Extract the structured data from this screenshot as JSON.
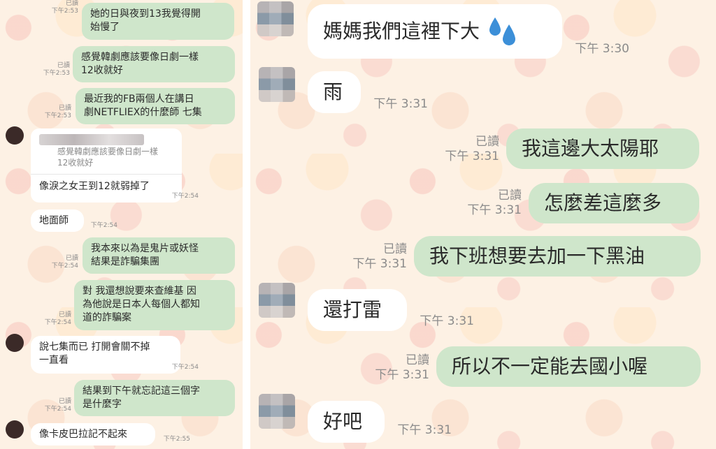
{
  "left_chat": {
    "messages": [
      {
        "side": "out",
        "read": "已讀",
        "time": "下午2:53",
        "text": "她的日與夜到13我覺得開\n始慢了"
      },
      {
        "side": "out",
        "read": "已讀",
        "time": "下午2:53",
        "text": "感覺韓劇應該要像日劇一樣\n12收就好"
      },
      {
        "side": "out",
        "read": "已讀",
        "time": "下午2:53",
        "text": "最近我的FB兩個人在講日\n劇NETFLIEX的什麼師 七集"
      },
      {
        "side": "in",
        "time": "下午2:54",
        "quote": "感覺韓劇應該要像日劇一樣\n12收就好",
        "text": "像淚之女王到12就弱掉了"
      },
      {
        "side": "in",
        "time": "下午2:54",
        "text": "地面師"
      },
      {
        "side": "out",
        "read": "已讀",
        "time": "下午2:54",
        "text": "我本來以為是鬼片或妖怪\n結果是詐騙集團"
      },
      {
        "side": "out",
        "read": "已讀",
        "time": "下午2:54",
        "text": "對 我還想說要來查維基 因\n為他說是日本人每個人都知\n道的詐騙案"
      },
      {
        "side": "in",
        "time": "下午2:54",
        "text": "說七集而已 打開會關不掉\n一直看"
      },
      {
        "side": "out",
        "read": "已讀",
        "time": "下午2:54",
        "text": "結果到下午就忘記這三個字\n是什麼字"
      },
      {
        "side": "in",
        "time": "下午2:55",
        "text": "像卡皮巴拉記不起來"
      }
    ]
  },
  "right_chat": {
    "messages": [
      {
        "side": "in",
        "time": "下午 3:30",
        "text": "媽媽我們這裡下大",
        "icon": "droplets-icon"
      },
      {
        "side": "in",
        "time": "下午 3:31",
        "text": "雨"
      },
      {
        "side": "out",
        "read": "已讀",
        "time": "下午 3:31",
        "text": "我這邊大太陽耶"
      },
      {
        "side": "out",
        "read": "已讀",
        "time": "下午 3:31",
        "text": "怎麼差這麼多"
      },
      {
        "side": "out",
        "read": "已讀",
        "time": "下午 3:31",
        "text": "我下班想要去加一下黑油"
      },
      {
        "side": "in",
        "time": "下午 3:31",
        "text": "還打雷"
      },
      {
        "side": "out",
        "read": "已讀",
        "time": "下午 3:31",
        "text": "所以不一定能去國小喔"
      },
      {
        "side": "in",
        "time": "下午 3:31",
        "text": "好吧"
      }
    ]
  },
  "colors": {
    "outgoing_bubble": "#cfe6cb",
    "incoming_bubble": "#ffffff",
    "wallpaper": "#fdf1e4",
    "meta_text": "#8b8b8b",
    "droplet": "#3c8fd8"
  }
}
